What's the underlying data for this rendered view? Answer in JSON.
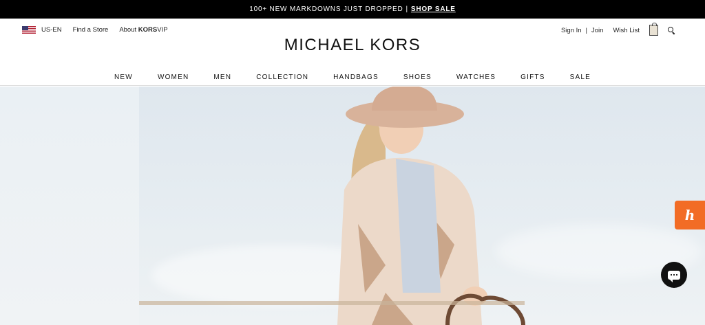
{
  "promo": {
    "text": "100+ NEW MARKDOWNS JUST DROPPED",
    "separator": "|",
    "link": "SHOP SALE"
  },
  "header": {
    "locale": "US-EN",
    "find_store": "Find a Store",
    "about_prefix": "About ",
    "about_brand": "KORS",
    "about_suffix": "VIP",
    "logo": "MICHAEL KORS",
    "sign_in": "Sign In",
    "divider": "|",
    "join": "Join",
    "wish_list": "Wish List"
  },
  "nav": {
    "items": [
      "NEW",
      "WOMEN",
      "MEN",
      "COLLECTION",
      "HANDBAGS",
      "SHOES",
      "WATCHES",
      "GIFTS",
      "SALE"
    ]
  },
  "widgets": {
    "honey_letter": "h",
    "honey_color": "#f26c25",
    "chat_color": "#111111"
  },
  "icons": {
    "flag": "us-flag-icon",
    "bag": "shopping-bag-icon",
    "search": "search-icon",
    "chat": "chat-bubble-icon"
  }
}
